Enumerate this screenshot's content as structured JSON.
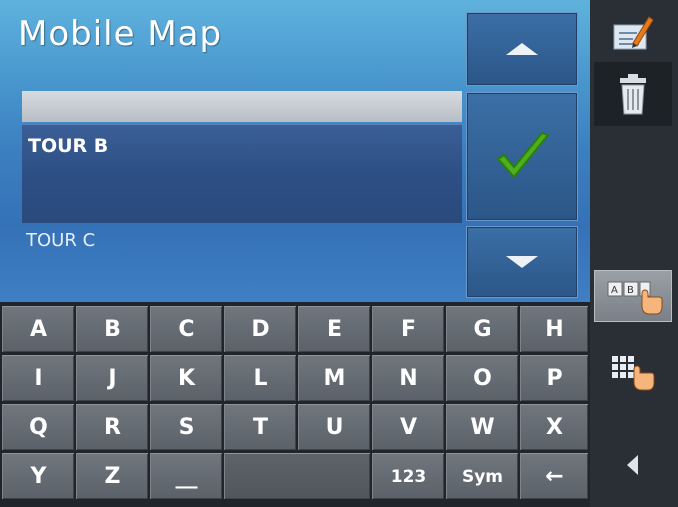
{
  "app": {
    "title": "Mobile Map"
  },
  "list": {
    "input_value": "",
    "selected_item": "TOUR B",
    "next_item": "TOUR C"
  },
  "keyboard": {
    "rows": [
      [
        "A",
        "B",
        "C",
        "D",
        "E",
        "F",
        "G",
        "H"
      ],
      [
        "I",
        "J",
        "K",
        "L",
        "M",
        "N",
        "O",
        "P"
      ],
      [
        "Q",
        "R",
        "S",
        "T",
        "U",
        "V",
        "W",
        "X"
      ]
    ],
    "last_row": [
      "Y",
      "Z",
      "__",
      "",
      "",
      "123",
      "Sym",
      "←"
    ]
  },
  "icons": {
    "up": "arrow-up-icon",
    "ok": "checkmark-icon",
    "down": "arrow-down-icon",
    "notes": "edit-notes-icon",
    "trash": "trash-icon",
    "ab_mode": "abc-keyboard-icon",
    "grid_mode": "keypad-grid-icon",
    "back": "back-arrow-icon"
  },
  "colors": {
    "accent_blue": "#3b7fc0",
    "check_green": "#4caf1e"
  }
}
